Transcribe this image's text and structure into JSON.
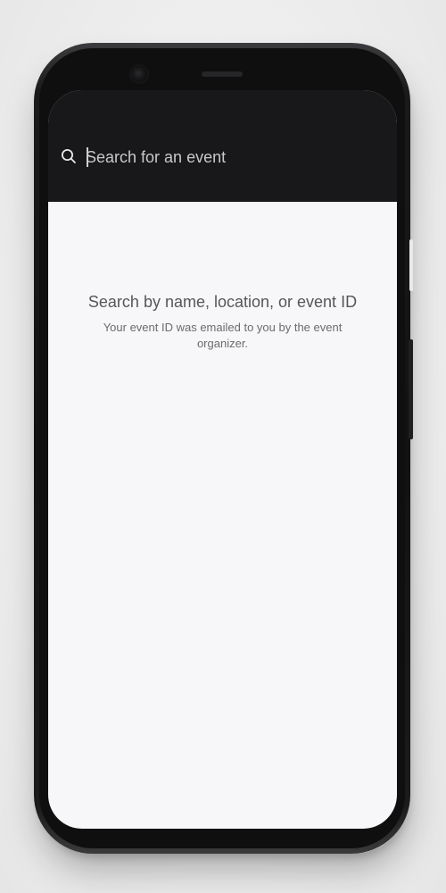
{
  "search": {
    "placeholder": "Search for an event",
    "value": "",
    "icon": "search-icon"
  },
  "empty_state": {
    "title": "Search by name, location, or event ID",
    "subtitle": "Your event ID was emailed to you by the event organizer."
  },
  "colors": {
    "header_background": "#18181a",
    "screen_background": "#f7f7f9",
    "title_text": "#56565b",
    "subtitle_text": "#6b6b70"
  }
}
